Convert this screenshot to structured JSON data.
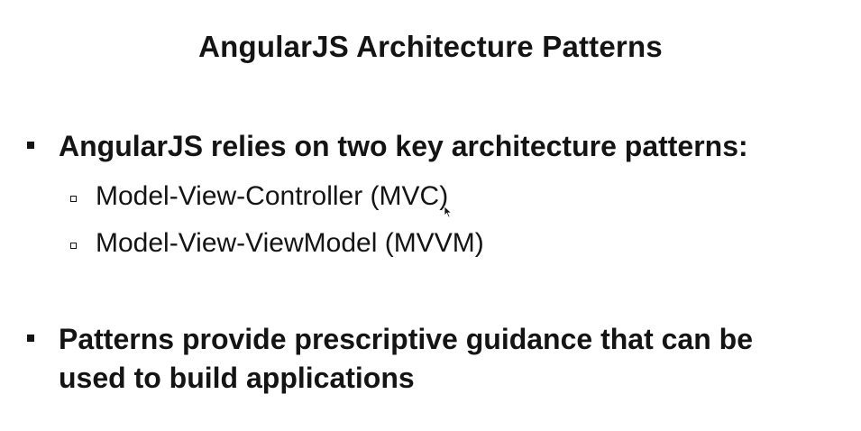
{
  "slide": {
    "title": "AngularJS Architecture Patterns",
    "bullets": [
      {
        "text": "AngularJS relies on two key architecture patterns:",
        "sub_items": [
          "Model-View-Controller (MVC)",
          "Model-View-ViewModel (MVVM)"
        ]
      },
      {
        "line1": "Patterns provide prescriptive guidance that can be",
        "line2": "used to build applications"
      }
    ]
  },
  "colors": {
    "text": "#141414",
    "background": "#ffffff"
  },
  "icons": {
    "bullet": "filled-square-bullet-icon",
    "sub_bullet": "hollow-square-bullet-icon",
    "cursor": "mouse-pointer-icon"
  }
}
